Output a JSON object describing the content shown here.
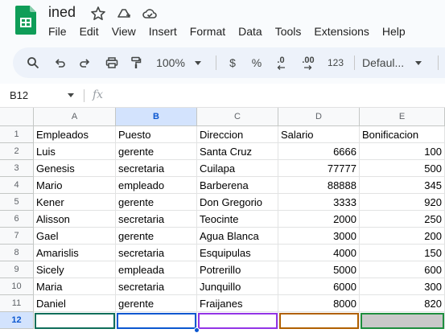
{
  "app": {
    "title": "ined",
    "menu": [
      "File",
      "Edit",
      "View",
      "Insert",
      "Format",
      "Data",
      "Tools",
      "Extensions",
      "Help"
    ]
  },
  "toolbar": {
    "zoom": "100%",
    "currency": "$",
    "percent": "%",
    "decimal_decrease": ".0",
    "decimal_increase": ".00",
    "number_format": "123",
    "font": "Defaul..."
  },
  "formula_bar": {
    "name_box": "B12",
    "fx": "fx",
    "value": ""
  },
  "sheet": {
    "columns": [
      "A",
      "B",
      "C",
      "D",
      "E"
    ],
    "selected_column": "B",
    "selected_row": "12",
    "row_numbers": [
      "1",
      "2",
      "3",
      "4",
      "5",
      "6",
      "7",
      "8",
      "9",
      "10",
      "11",
      "12"
    ],
    "rows": [
      [
        "Empleados",
        "Puesto",
        "Direccion",
        "Salario",
        "Bonificacion"
      ],
      [
        "Luis",
        "gerente",
        "Santa Cruz",
        "6666",
        "100"
      ],
      [
        "Genesis",
        "secretaria",
        "Cuilapa",
        "77777",
        "500"
      ],
      [
        "Mario",
        "empleado",
        "Barberena",
        "88888",
        "345"
      ],
      [
        "Kener",
        "gerente",
        "Don Gregorio",
        "3333",
        "920"
      ],
      [
        "Alisson",
        "secretaria",
        "Teocinte",
        "2000",
        "250"
      ],
      [
        "Gael",
        "gerente",
        "Agua Blanca",
        "3000",
        "200"
      ],
      [
        "Amarislis",
        "secretaria",
        "Esquipulas",
        "4000",
        "150"
      ],
      [
        "Sicely",
        "empleada",
        "Potrerillo",
        "5000",
        "600"
      ],
      [
        "Maria",
        "secretaria",
        "Junquillo",
        "6000",
        "300"
      ],
      [
        "Daniel",
        "gerente",
        "Fraijanes",
        "8000",
        "820"
      ],
      [
        "",
        "",
        "",
        "",
        ""
      ]
    ],
    "row12_colors": [
      "#0f6e5b",
      "#0b57d0",
      "#9334e6",
      "#b06000",
      "#1e8e3e"
    ]
  }
}
